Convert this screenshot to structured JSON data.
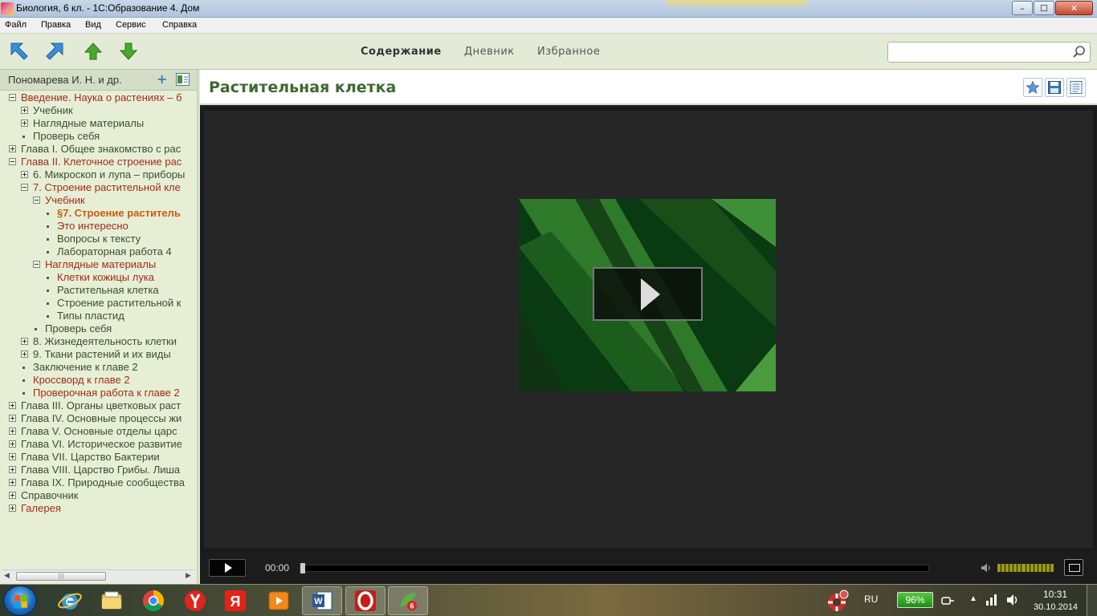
{
  "window": {
    "title": "Биология, 6 кл. - 1С:Образование 4. Дом",
    "minimize_icon": "minimize-icon",
    "maximize_icon": "maximize-icon",
    "close_icon": "close-icon"
  },
  "menu": [
    "Файл",
    "Правка",
    "Вид",
    "Сервис",
    "Справка"
  ],
  "toolbar": {
    "nav_icons": [
      "arrow-back-icon",
      "arrow-forward-icon",
      "arrow-up-icon",
      "arrow-down-icon"
    ],
    "tabs": [
      {
        "label": "Содержание",
        "active": true
      },
      {
        "label": "Дневник",
        "active": false
      },
      {
        "label": "Избранное",
        "active": false
      }
    ],
    "search_value": "",
    "search_placeholder": ""
  },
  "sidebar": {
    "author": "Пономарева И. Н. и др.",
    "tree": [
      {
        "label": "Введение. Наука о растениях – б",
        "level": 0,
        "marker": "minus",
        "color": "red"
      },
      {
        "label": "Учебник",
        "level": 1,
        "marker": "plus",
        "color": "green"
      },
      {
        "label": "Наглядные материалы",
        "level": 1,
        "marker": "plus",
        "color": "green"
      },
      {
        "label": "Проверь себя",
        "level": 1,
        "marker": "dot",
        "color": "green"
      },
      {
        "label": "Глава I. Общее знакомство с рас",
        "level": 0,
        "marker": "plus",
        "color": "green"
      },
      {
        "label": "Глава II. Клеточное строение рас",
        "level": 0,
        "marker": "minus",
        "color": "red"
      },
      {
        "label": "6. Микроскоп и лупа – приборы",
        "level": 1,
        "marker": "plus",
        "color": "green"
      },
      {
        "label": "7. Строение растительной кле",
        "level": 1,
        "marker": "minus",
        "color": "red"
      },
      {
        "label": "Учебник",
        "level": 2,
        "marker": "minus",
        "color": "red"
      },
      {
        "label": "§7. Строение раститель",
        "level": 3,
        "marker": "dot",
        "color": "orange"
      },
      {
        "label": "Это интересно",
        "level": 3,
        "marker": "dot",
        "color": "red"
      },
      {
        "label": "Вопросы к тексту",
        "level": 3,
        "marker": "dot",
        "color": "green"
      },
      {
        "label": "Лабораторная работа 4",
        "level": 3,
        "marker": "dot",
        "color": "green"
      },
      {
        "label": "Наглядные материалы",
        "level": 2,
        "marker": "minus",
        "color": "red"
      },
      {
        "label": "Клетки кожицы лука",
        "level": 3,
        "marker": "dot",
        "color": "red"
      },
      {
        "label": "Растительная клетка",
        "level": 3,
        "marker": "dot",
        "color": "green"
      },
      {
        "label": "Строение растительной к",
        "level": 3,
        "marker": "dot",
        "color": "green"
      },
      {
        "label": "Типы пластид",
        "level": 3,
        "marker": "dot",
        "color": "green"
      },
      {
        "label": "Проверь себя",
        "level": 2,
        "marker": "dot",
        "color": "green"
      },
      {
        "label": "8. Жизнедеятельность клетки",
        "level": 1,
        "marker": "plus",
        "color": "green"
      },
      {
        "label": "9. Ткани растений и их виды",
        "level": 1,
        "marker": "plus",
        "color": "green"
      },
      {
        "label": "Заключение к главе 2",
        "level": 1,
        "marker": "dot",
        "color": "green"
      },
      {
        "label": "Кроссворд к главе 2",
        "level": 1,
        "marker": "dot",
        "color": "red"
      },
      {
        "label": "Проверочная работа к главе 2",
        "level": 1,
        "marker": "dot",
        "color": "red"
      },
      {
        "label": "Глава III. Органы цветковых раст",
        "level": 0,
        "marker": "plus",
        "color": "green"
      },
      {
        "label": "Глава IV. Основные процессы жи",
        "level": 0,
        "marker": "plus",
        "color": "green"
      },
      {
        "label": "Глава V. Основные отделы царс",
        "level": 0,
        "marker": "plus",
        "color": "green"
      },
      {
        "label": "Глава VI. Историческое развитие",
        "level": 0,
        "marker": "plus",
        "color": "green"
      },
      {
        "label": "Глава VII. Царство Бактерии",
        "level": 0,
        "marker": "plus",
        "color": "green"
      },
      {
        "label": "Глава VIII. Царство Грибы. Лиша",
        "level": 0,
        "marker": "plus",
        "color": "green"
      },
      {
        "label": "Глава IX. Природные сообщества",
        "level": 0,
        "marker": "plus",
        "color": "green"
      },
      {
        "label": "Справочник",
        "level": 0,
        "marker": "plus",
        "color": "green"
      },
      {
        "label": "Галерея",
        "level": 0,
        "marker": "plus",
        "color": "red"
      }
    ],
    "scrollbar_thumb": "|||"
  },
  "content": {
    "title": "Растительная клетка",
    "header_icons": [
      "favorite-star-icon",
      "save-disk-icon",
      "notes-icon"
    ],
    "player": {
      "time": "00:00",
      "progress": 0,
      "volume": 1.0
    }
  },
  "taskbar": {
    "apps": [
      "internet-explorer-icon",
      "file-explorer-icon",
      "chrome-icon",
      "yandex-browser-icon",
      "yandex-icon",
      "media-player-icon",
      "word-icon",
      "opera-icon",
      "1c-education-icon"
    ],
    "language": "RU",
    "battery": "96%",
    "clock_time": "10:31",
    "clock_date": "30.10.2014"
  },
  "colors": {
    "accent_green": "#3c6a2e",
    "tree_red": "#a22a1a",
    "tree_orange": "#c95a10",
    "sidebar_bg": "#e6efd6"
  }
}
